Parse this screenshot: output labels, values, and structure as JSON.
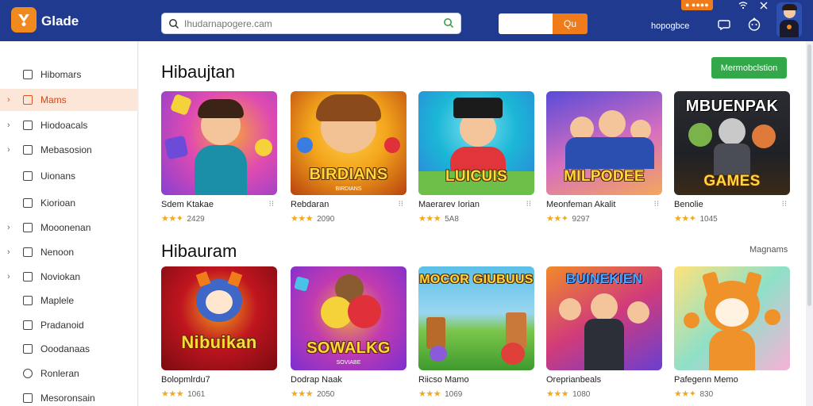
{
  "header": {
    "app_name": "Glade",
    "search_placeholder": "Ihudarnapogere.cam",
    "promo_button": "Qu",
    "coin_badge": "● ●●●●",
    "username": "hopogbce"
  },
  "sidebar": {
    "items": [
      {
        "label": "Hibomars",
        "chevron": false,
        "active": false
      },
      {
        "label": "Mams",
        "chevron": true,
        "active": true
      },
      {
        "label": "Hiodoacals",
        "chevron": true,
        "active": false
      },
      {
        "label": "Mebasosion",
        "chevron": true,
        "active": false
      },
      {
        "label": "Uionans",
        "chevron": false,
        "active": false
      },
      {
        "label": "Kiorioan",
        "chevron": false,
        "active": false
      },
      {
        "label": "Mooonenan",
        "chevron": true,
        "active": false
      },
      {
        "label": "Nenoon",
        "chevron": true,
        "active": false
      },
      {
        "label": "Noviokan",
        "chevron": true,
        "active": false
      },
      {
        "label": "Maplele",
        "chevron": false,
        "active": false
      },
      {
        "label": "Pradanoid",
        "chevron": false,
        "active": false
      },
      {
        "label": "Ooodanaas",
        "chevron": false,
        "active": false
      },
      {
        "label": "Ronleran",
        "chevron": false,
        "active": false
      },
      {
        "label": "Mesoronsain",
        "chevron": false,
        "active": false
      }
    ]
  },
  "sections": [
    {
      "title": "Hibaujtan",
      "action_label": "Mermobclstion",
      "games": [
        {
          "title": "Sdem Ktakae",
          "rating_text": "2429",
          "stars": "★★✦",
          "thumb_caption": "",
          "colors": [
            "#8a3fd1",
            "#e04bb0",
            "#f6a23a"
          ]
        },
        {
          "title": "Rebdaran",
          "rating_text": "2090",
          "stars": "★★★",
          "thumb_caption": "BIRDIANS",
          "thumb_sub": "BIRDIANS",
          "colors": [
            "#f3a51c",
            "#e86a12",
            "#b8420f"
          ]
        },
        {
          "title": "Maerarev Iorian",
          "rating_text": "5A8",
          "stars": "★★★",
          "thumb_caption": "LUICUIS",
          "colors": [
            "#1bb7d7",
            "#2f7ed8",
            "#8ed36c"
          ]
        },
        {
          "title": "Meonfeman Akalit",
          "rating_text": "9297",
          "stars": "★★✦",
          "thumb_caption": "MILPODEE",
          "colors": [
            "#5a4bd8",
            "#d86fbf",
            "#f3a85a"
          ]
        },
        {
          "title": "Benolie",
          "rating_text": "1045",
          "stars": "★★✦",
          "thumb_caption": "MBUENPAK",
          "thumb_caption2": "GAMES",
          "colors": [
            "#1f2126",
            "#3a3d45",
            "#7a5a2a"
          ]
        }
      ]
    },
    {
      "title": "Hibauram",
      "action_label": "Magnams",
      "games": [
        {
          "title": "Bolopmlrdu7",
          "rating_text": "1061",
          "stars": "★★★",
          "thumb_caption": "Nibuikan",
          "colors": [
            "#c0151f",
            "#7a0b10",
            "#f2a21c"
          ]
        },
        {
          "title": "Dodrap Naak",
          "rating_text": "2050",
          "stars": "★★★",
          "thumb_caption": "SOWALKG",
          "thumb_sub": "SOVIABE",
          "colors": [
            "#7c2fd1",
            "#c23bb0",
            "#f0a53a"
          ]
        },
        {
          "title": "Riicso Mamo",
          "rating_text": "1069",
          "stars": "★★★",
          "thumb_caption": "MOCOR GIUBUUS",
          "colors": [
            "#5cc0e8",
            "#7bc64a",
            "#3e9a2f"
          ]
        },
        {
          "title": "Oreprianbeals",
          "rating_text": "1080",
          "stars": "★★★",
          "thumb_caption": "BUINEKIEN",
          "colors": [
            "#f08a2a",
            "#d13b7a",
            "#6a3fd1"
          ]
        },
        {
          "title": "Pafegenn Memo",
          "rating_text": "830",
          "stars": "★★✦",
          "thumb_caption": "",
          "colors": [
            "#ffe27a",
            "#8fe0c8",
            "#f7b2d6"
          ]
        }
      ]
    }
  ],
  "colors": {
    "header_bg": "#1f3a8f",
    "accent_orange": "#f07b1a",
    "active_sidebar_bg": "#fbe6d7",
    "green_button": "#33a84a",
    "star_color": "#f2a91e"
  }
}
